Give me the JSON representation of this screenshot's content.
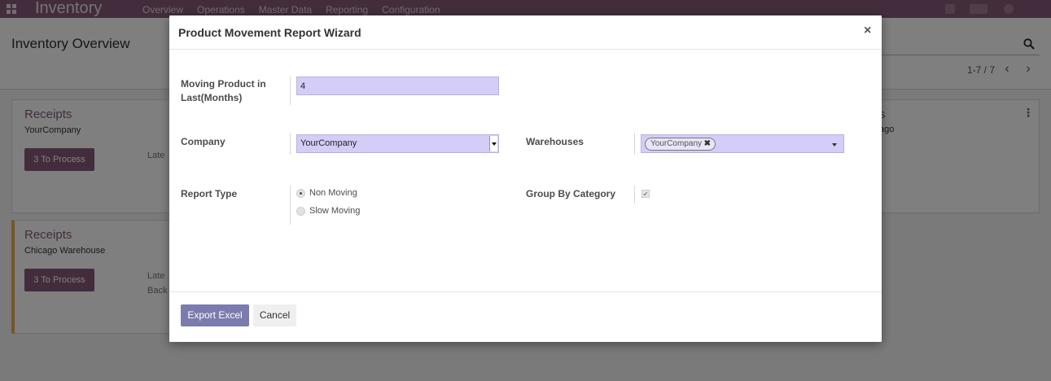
{
  "navbar": {
    "app_name": "Inventory",
    "menu": [
      "Overview",
      "Operations",
      "Master Data",
      "Reporting",
      "Configuration"
    ]
  },
  "control_panel": {
    "title": "Inventory Overview",
    "pager": "1-7 / 7"
  },
  "kanban": [
    {
      "title": "Receipts",
      "subtitle": "YourCompany",
      "button": "3 To Process",
      "lines": [
        "Late"
      ]
    },
    {
      "title": "Receipts",
      "subtitle": "Chicago Warehouse",
      "button": "3 To Process",
      "lines": [
        "Late",
        "Back"
      ]
    }
  ],
  "kanban_right": {
    "title": "s",
    "subtitle": "ago"
  },
  "modal": {
    "title": "Product Movement Report Wizard",
    "close_symbol": "×",
    "fields": {
      "moving_months": {
        "label": "Moving Product in Last(Months)",
        "value": "4"
      },
      "company": {
        "label": "Company",
        "value": "YourCompany"
      },
      "warehouses": {
        "label": "Warehouses",
        "tags": [
          "YourCompany"
        ],
        "tag_remove_symbol": "✖"
      },
      "report_type": {
        "label": "Report Type",
        "options": [
          {
            "label": "Non Moving",
            "checked": true
          },
          {
            "label": "Slow Moving",
            "checked": false
          }
        ]
      },
      "group_by_category": {
        "label": "Group By Category",
        "checked": true,
        "check_symbol": "✔"
      }
    },
    "footer": {
      "export_label": "Export Excel",
      "cancel_label": "Cancel"
    }
  },
  "colors": {
    "brand": "#875a7b",
    "primary_button": "#7c7bad",
    "field_bg": "#d3cdf7",
    "late_border": "#f0ad4e"
  }
}
